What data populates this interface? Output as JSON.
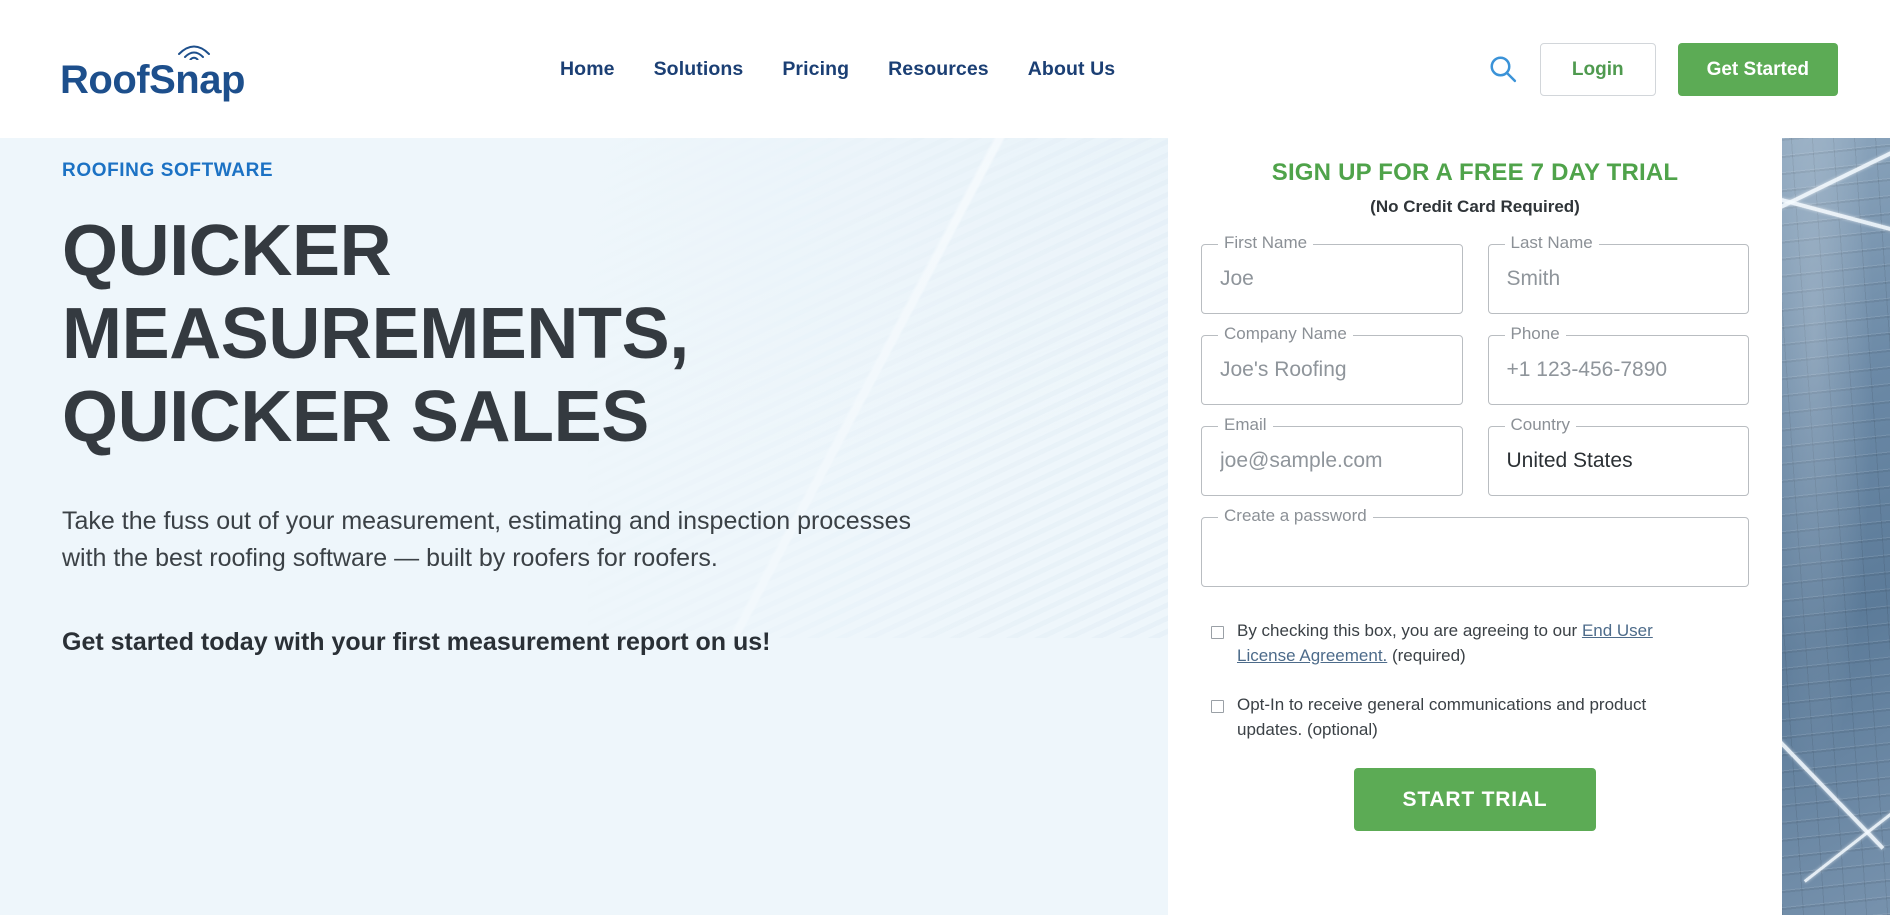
{
  "header": {
    "logo": {
      "part1": "Roof",
      "part2": "Snap",
      "icon": "wifi-signal-arc-icon"
    },
    "nav": [
      {
        "label": "Home"
      },
      {
        "label": "Solutions"
      },
      {
        "label": "Pricing"
      },
      {
        "label": "Resources"
      },
      {
        "label": "About Us"
      }
    ],
    "search_icon": "search-icon",
    "login_label": "Login",
    "get_started_label": "Get Started"
  },
  "hero": {
    "eyebrow": "ROOFING SOFTWARE",
    "heading": "QUICKER MEASUREMENTS, QUICKER SALES",
    "paragraph": "Take the fuss out of your measurement, estimating and inspection processes with the best roofing software — built by roofers for roofers.",
    "cta_text": "Get started today with your first measurement report on us!"
  },
  "signup": {
    "title": "SIGN UP FOR A FREE 7 DAY TRIAL",
    "subtitle": "(No Credit Card Required)",
    "fields": [
      {
        "label": "First Name",
        "placeholder": "Joe",
        "value": ""
      },
      {
        "label": "Last Name",
        "placeholder": "Smith",
        "value": ""
      },
      {
        "label": "Company Name",
        "placeholder": "Joe's Roofing",
        "value": ""
      },
      {
        "label": "Phone",
        "placeholder": "+1 123-456-7890",
        "value": ""
      },
      {
        "label": "Email",
        "placeholder": "joe@sample.com",
        "value": ""
      },
      {
        "label": "Country",
        "placeholder": "",
        "value": "United States"
      },
      {
        "label": "Create a password",
        "placeholder": "",
        "value": ""
      }
    ],
    "checkbox_eula_prefix": "By checking this box, you are agreeing to our ",
    "checkbox_eula_link": "End User License Agreement.",
    "checkbox_eula_suffix": " (required)",
    "checkbox_optin": "Opt-In to receive general communications and product updates. (optional)",
    "submit_label": "START TRIAL"
  },
  "colors": {
    "brand_blue": "#1d4f8c",
    "nav_blue": "#1b3f74",
    "accent_green": "#5cab55",
    "title_green": "#4fa34a",
    "eyebrow_blue": "#1c72c4",
    "hero_bg": "#eef6fb",
    "heading_dark": "#343a40"
  }
}
